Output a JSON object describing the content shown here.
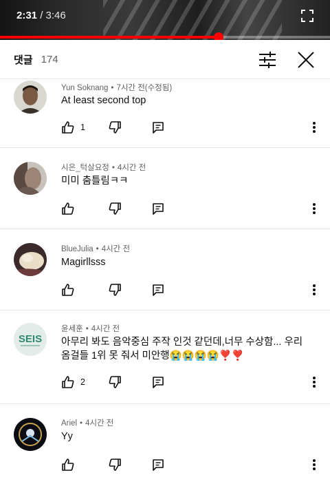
{
  "player": {
    "current_time": "2:31",
    "separator": " / ",
    "total_time": "3:46",
    "progress_fraction": 0.662,
    "accent": "#ff0000"
  },
  "header": {
    "title": "댓글",
    "count": "174",
    "filter_icon": "sort-filter-icon",
    "close_icon": "close-icon"
  },
  "comments": [
    {
      "author": "Yun Soknang",
      "time": "7시간 전(수정됨)",
      "text": "At least second top",
      "likes": "1",
      "avatar": "person-portrait-avatar"
    },
    {
      "author": "시은_턱살요정",
      "time": "4시간 전",
      "text": "미미 춤틀림ㅋㅋ",
      "likes": "",
      "avatar": "dark-photo-avatar"
    },
    {
      "author": "BlueJulia",
      "time": "4시간 전",
      "text": "Magirllsss",
      "likes": "",
      "avatar": "cat-photo-avatar"
    },
    {
      "author": "윤세훈",
      "time": "4시간 전",
      "text": "아무리 봐도 음악중심 주작 인것 같던데,너무 수상함... 우리 옴걸들 1위 못 줘서 미안행😭😭😭😭❣️❣️",
      "likes": "2",
      "avatar": "seis-logo-avatar"
    },
    {
      "author": "Ariel",
      "time": "4시간 전",
      "text": "Yy",
      "likes": "",
      "avatar": "emblem-avatar"
    }
  ]
}
